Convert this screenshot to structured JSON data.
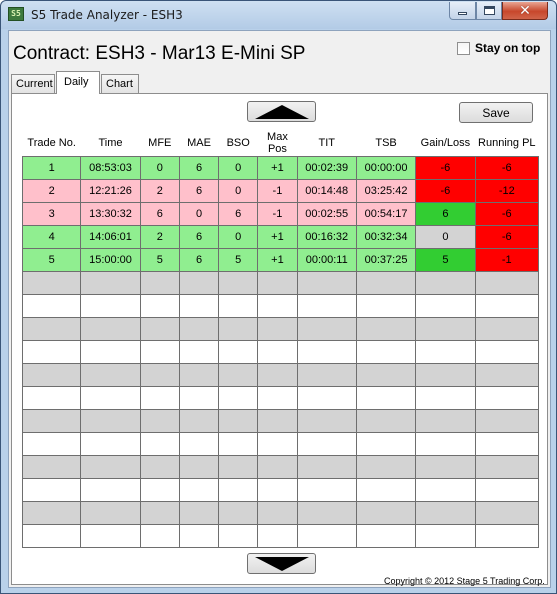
{
  "window": {
    "icon_text": "S5",
    "title": "S5 Trade Analyzer - ESH3",
    "close_glyph": "✕"
  },
  "header": {
    "contract_title": "Contract: ESH3 - Mar13 E-Mini SP",
    "stay_on_top_label": "Stay on top",
    "stay_on_top_checked": false
  },
  "tabs": [
    {
      "label": "Current",
      "active": false
    },
    {
      "label": "Daily",
      "active": true
    },
    {
      "label": "Chart",
      "active": false
    }
  ],
  "toolbar": {
    "save_label": "Save",
    "scroll_up_icon": "up-arrow",
    "scroll_down_icon": "down-arrow"
  },
  "table": {
    "columns": [
      "Trade No.",
      "Time",
      "MFE",
      "MAE",
      "BSO",
      "Max Pos",
      "TIT",
      "TSB",
      "Gain/Loss",
      "Running PL"
    ],
    "rows": [
      {
        "cells": [
          "1",
          "08:53:03",
          "0",
          "6",
          "0",
          "+1",
          "00:02:39",
          "00:00:00",
          "-6",
          "-6"
        ],
        "row_color": "#90ee90",
        "gain_color": "#ff0000",
        "pl_color": "#ff0000"
      },
      {
        "cells": [
          "2",
          "12:21:26",
          "2",
          "6",
          "0",
          "-1",
          "00:14:48",
          "03:25:42",
          "-6",
          "-12"
        ],
        "row_color": "#ffc0cb",
        "gain_color": "#ff0000",
        "pl_color": "#ff0000"
      },
      {
        "cells": [
          "3",
          "13:30:32",
          "6",
          "0",
          "6",
          "-1",
          "00:02:55",
          "00:54:17",
          "6",
          "-6"
        ],
        "row_color": "#ffc0cb",
        "gain_color": "#32cd32",
        "pl_color": "#ff0000"
      },
      {
        "cells": [
          "4",
          "14:06:01",
          "2",
          "6",
          "0",
          "+1",
          "00:16:32",
          "00:32:34",
          "0",
          "-6"
        ],
        "row_color": "#90ee90",
        "gain_color": "#d3d3d3",
        "pl_color": "#ff0000"
      },
      {
        "cells": [
          "5",
          "15:00:00",
          "5",
          "6",
          "5",
          "+1",
          "00:00:11",
          "00:37:25",
          "5",
          "-1"
        ],
        "row_color": "#90ee90",
        "gain_color": "#32cd32",
        "pl_color": "#ff0000"
      }
    ],
    "empty_row_colors": [
      "#d3d3d3",
      "#ffffff",
      "#d3d3d3",
      "#ffffff",
      "#d3d3d3",
      "#ffffff",
      "#d3d3d3",
      "#ffffff",
      "#d3d3d3",
      "#ffffff",
      "#d3d3d3",
      "#ffffff"
    ]
  },
  "footer": {
    "copyright": "Copyright © 2012 Stage 5 Trading Corp."
  }
}
